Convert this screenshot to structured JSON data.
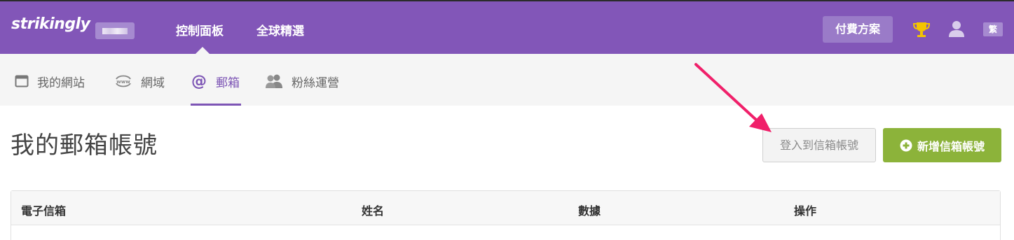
{
  "brand": {
    "logo_text": "strikingly"
  },
  "topnav": {
    "items": [
      "控制面板",
      "全球精選"
    ]
  },
  "header_right": {
    "pay_label": "付費方案",
    "lang_label": "繁",
    "trophy_color": "#f4c400"
  },
  "subnav": {
    "items": [
      {
        "label": "我的網站",
        "icon": "browser-window-icon"
      },
      {
        "label": "網域",
        "icon": "www-globe-icon"
      },
      {
        "label": "郵箱",
        "icon": "at-sign-icon",
        "active": true
      },
      {
        "label": "粉絲運營",
        "icon": "users-icon"
      }
    ]
  },
  "main": {
    "title": "我的郵箱帳號",
    "login_button": "登入到信箱帳號",
    "add_button": "新增信箱帳號"
  },
  "table": {
    "columns": [
      "電子信箱",
      "姓名",
      "數據",
      "操作"
    ]
  },
  "colors": {
    "brand_purple": "#8256b8",
    "accent_purple": "#7d55b5",
    "add_green": "#8cb33a",
    "annotation_arrow": "#f0206a"
  }
}
